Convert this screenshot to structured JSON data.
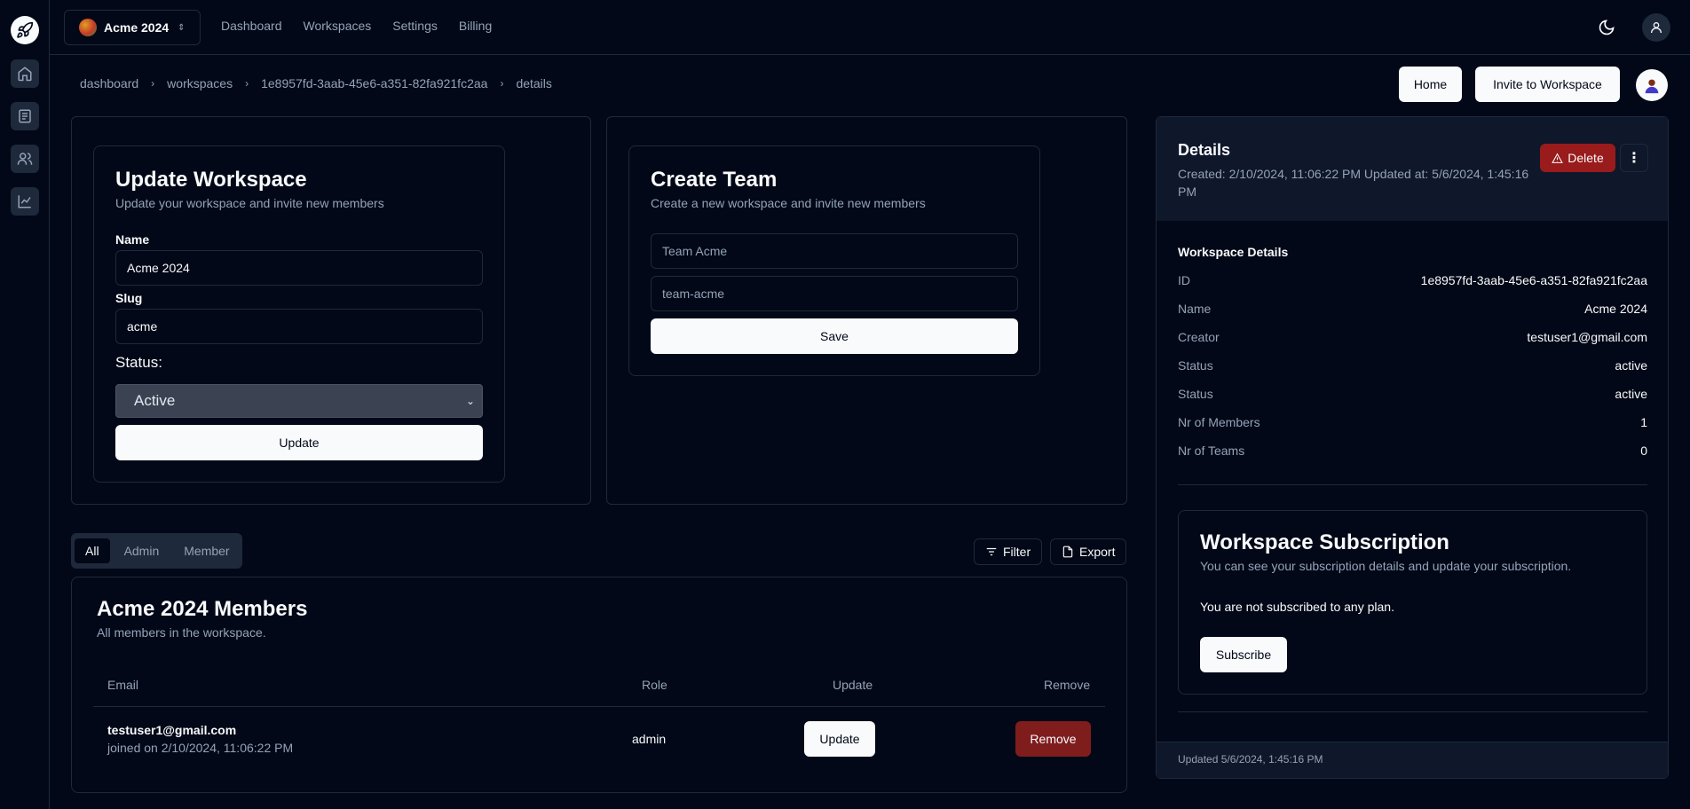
{
  "app": {
    "workspace_name": "Acme 2024"
  },
  "nav": [
    "Dashboard",
    "Workspaces",
    "Settings",
    "Billing"
  ],
  "breadcrumb": [
    "dashboard",
    "workspaces",
    "1e8957fd-3aab-45e6-a351-82fa921fc2aa",
    "details"
  ],
  "header_actions": {
    "home": "Home",
    "invite": "Invite to Workspace"
  },
  "update_workspace": {
    "title": "Update Workspace",
    "subtitle": "Update your workspace and invite new members",
    "name_label": "Name",
    "name_value": "Acme 2024",
    "slug_label": "Slug",
    "slug_value": "acme",
    "status_label": "Status:",
    "status_value": "Active",
    "button": "Update"
  },
  "create_team": {
    "title": "Create Team",
    "subtitle": "Create a new workspace and invite new members",
    "name_placeholder": "Team Acme",
    "slug_placeholder": "team-acme",
    "button": "Save"
  },
  "member_tabs": [
    "All",
    "Admin",
    "Member"
  ],
  "member_actions": {
    "filter": "Filter",
    "export": "Export"
  },
  "members": {
    "title": "Acme 2024 Members",
    "subtitle": "All members in the workspace.",
    "columns": [
      "Email",
      "Role",
      "Update",
      "Remove"
    ],
    "rows": [
      {
        "email": "testuser1@gmail.com",
        "joined": "joined on 2/10/2024, 11:06:22 PM",
        "role": "admin",
        "update_label": "Update",
        "remove_label": "Remove"
      }
    ]
  },
  "details": {
    "title": "Details",
    "meta": "Created: 2/10/2024, 11:06:22 PM Updated at: 5/6/2024, 1:45:16 PM",
    "delete_label": "Delete",
    "section_title": "Workspace Details",
    "rows": [
      {
        "k": "ID",
        "v": "1e8957fd-3aab-45e6-a351-82fa921fc2aa"
      },
      {
        "k": "Name",
        "v": "Acme 2024"
      },
      {
        "k": "Creator",
        "v": "testuser1@gmail.com"
      },
      {
        "k": "Status",
        "v": "active"
      },
      {
        "k": "Status",
        "v": "active"
      },
      {
        "k": "Nr of Members",
        "v": "1"
      },
      {
        "k": "Nr of Teams",
        "v": "0"
      }
    ],
    "subscription_title": "Workspace Subscription",
    "subscription_sub": "You can see your subscription details and update your subscription.",
    "subscription_status": "You are not subscribed to any plan.",
    "subscribe_label": "Subscribe",
    "footer": "Updated 5/6/2024, 1:45:16 PM"
  }
}
